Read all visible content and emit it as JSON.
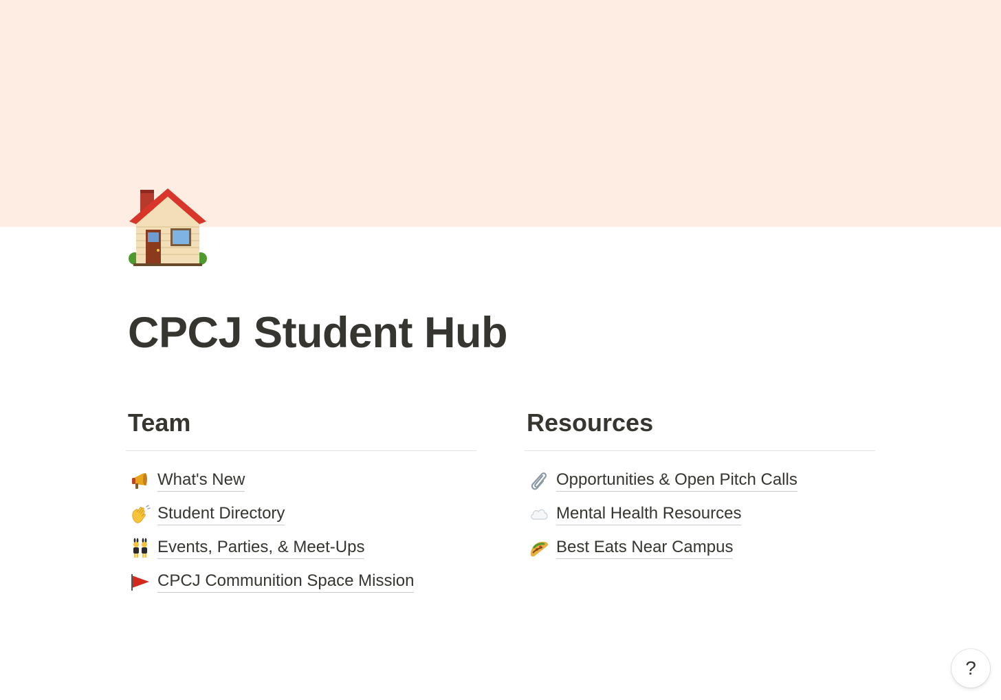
{
  "page": {
    "title": "CPCJ Student Hub",
    "icon": "house-icon",
    "cover_color": "#feede3"
  },
  "team": {
    "heading": "Team",
    "items": [
      {
        "icon": "megaphone-icon",
        "label": "What's New"
      },
      {
        "icon": "waving-hand-icon",
        "label": "Student Directory"
      },
      {
        "icon": "people-with-bunny-ears-icon",
        "label": "Events, Parties, & Meet-Ups"
      },
      {
        "icon": "red-flag-icon",
        "label": "CPCJ Communition Space Mission"
      }
    ]
  },
  "resources": {
    "heading": "Resources",
    "items": [
      {
        "icon": "paperclip-icon",
        "label": "Opportunities & Open Pitch Calls"
      },
      {
        "icon": "cloud-icon",
        "label": "Mental Health Resources"
      },
      {
        "icon": "taco-icon",
        "label": "Best Eats Near Campus"
      }
    ]
  },
  "help": {
    "label": "?"
  }
}
